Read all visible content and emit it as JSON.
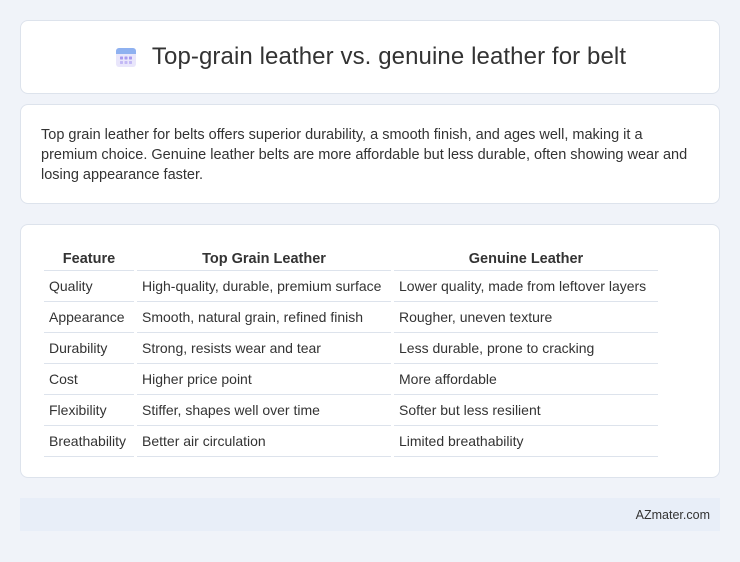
{
  "header": {
    "icon": "calendar-icon",
    "title": "Top-grain leather vs. genuine leather for belt"
  },
  "summary": {
    "text": "Top grain leather for belts offers superior durability, a smooth finish, and ages well, making it a premium choice. Genuine leather belts are more affordable but less durable, often showing wear and losing appearance faster."
  },
  "table": {
    "headers": [
      "Feature",
      "Top Grain Leather",
      "Genuine Leather"
    ],
    "rows": [
      [
        "Quality",
        "High-quality, durable, premium surface",
        "Lower quality, made from leftover layers"
      ],
      [
        "Appearance",
        "Smooth, natural grain, refined finish",
        "Rougher, uneven texture"
      ],
      [
        "Durability",
        "Strong, resists wear and tear",
        "Less durable, prone to cracking"
      ],
      [
        "Cost",
        "Higher price point",
        "More affordable"
      ],
      [
        "Flexibility",
        "Stiffer, shapes well over time",
        "Softer but less resilient"
      ],
      [
        "Breathability",
        "Better air circulation",
        "Limited breathability"
      ]
    ]
  },
  "footer": {
    "text": "AZmater.com"
  },
  "colors": {
    "background": "#f0f3f9",
    "card": "#ffffff",
    "footer": "#e8eef8",
    "icon_accent": "#8a7de8"
  }
}
